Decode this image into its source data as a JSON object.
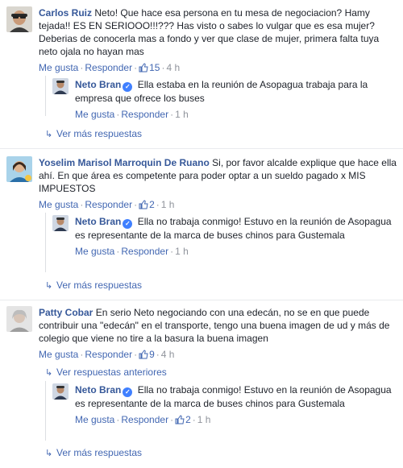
{
  "threads": [
    {
      "author": "Carlos Ruiz",
      "text": "Neto! Que hace esa persona en tu mesa de negociacion? Hamy tejada!! ES EN SERIOOO!!!??? Has visto o sabes lo vulgar que es esa mujer? Deberias de conocerla mas a fondo y ver que clase de mujer, primera falta tuya neto ojala no hayan mas",
      "like_label": "Me gusta",
      "reply_label": "Responder",
      "likes": "15",
      "time": "4 h",
      "replies": [
        {
          "author": "Neto Bran",
          "text": "Ella estaba en la reunión de Asopagua trabaja para la empresa que ofrece los buses",
          "like_label": "Me gusta",
          "reply_label": "Responder",
          "likes": "",
          "time": "1 h"
        }
      ],
      "more_label": "Ver más respuestas"
    },
    {
      "author": "Yoselim Marisol Marroquin De Ruano",
      "text": "Si, por favor alcalde explique que hace ella ahí. En que área es competente para poder optar a un sueldo pagado x MIS IMPUESTOS",
      "like_label": "Me gusta",
      "reply_label": "Responder",
      "likes": "2",
      "time": "1 h",
      "replies": [
        {
          "author": "Neto Bran",
          "text": "Ella no trabaja conmigo! Estuvo en la reunión de Asopagua es representante de la marca de buses chinos para Gustemala",
          "like_label": "Me gusta",
          "reply_label": "Responder",
          "likes": "",
          "time": "1 h"
        }
      ],
      "more_label": "Ver más respuestas"
    },
    {
      "author": "Patty Cobar",
      "text": "En serio Neto negociando con una edecán, no se en que puede contribuir una \"edecán\" en el transporte, tengo una buena imagen de ud y más de colegio que viene no tire a la basura la buena imagen",
      "like_label": "Me gusta",
      "reply_label": "Responder",
      "likes": "9",
      "time": "4 h",
      "previous_label": "Ver respuestas anteriores",
      "replies": [
        {
          "author": "Neto Bran",
          "text": "Ella no trabaja conmigo! Estuvo en la reunión de Asopagua es representante de la marca de buses chinos para Gustemala",
          "like_label": "Me gusta",
          "reply_label": "Responder",
          "likes": "2",
          "time": "1 h"
        }
      ],
      "more_label": "Ver más respuestas"
    }
  ],
  "colors": {
    "link": "#4267b2",
    "author": "#365899",
    "meta": "#90949c",
    "verified": "#4080ff"
  }
}
